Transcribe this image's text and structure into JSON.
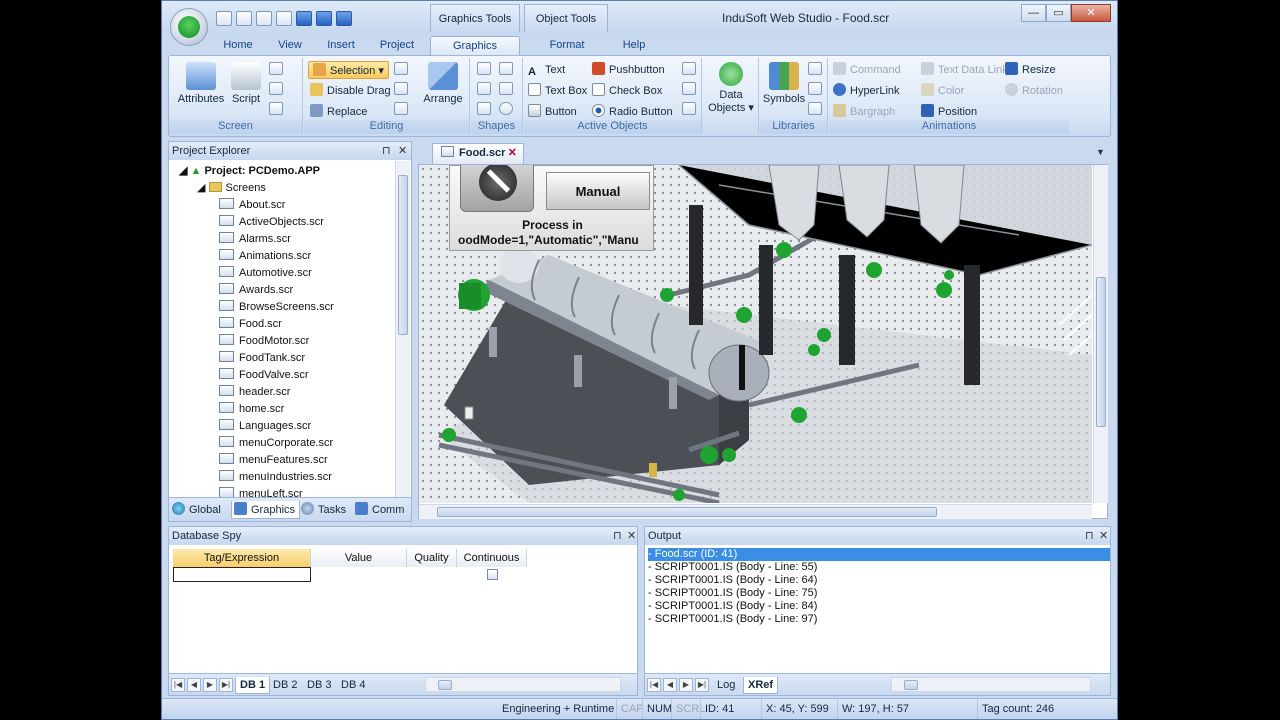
{
  "window": {
    "title": "InduSoft Web Studio - Food.scr",
    "context_tabs": [
      "Graphics Tools",
      "Object Tools"
    ],
    "controls": [
      "—",
      "▭",
      "✕"
    ]
  },
  "ribbon_tabs": [
    "Home",
    "View",
    "Insert",
    "Project",
    "Graphics",
    "Format",
    "Help"
  ],
  "ribbon": {
    "screen": {
      "label": "Screen",
      "attributes": "Attributes",
      "script": "Script"
    },
    "editing": {
      "label": "Editing",
      "selection": "Selection",
      "disable_drag": "Disable Drag",
      "replace": "Replace",
      "arrange": "Arrange"
    },
    "shapes": {
      "label": "Shapes"
    },
    "active_objects": {
      "label": "Active Objects",
      "text": "Text",
      "text_box": "Text Box",
      "button": "Button",
      "pushbutton": "Pushbutton",
      "check_box": "Check Box",
      "radio_button": "Radio Button"
    },
    "data_objects": {
      "line1": "Data",
      "line2": "Objects"
    },
    "libraries": {
      "label": "Libraries",
      "symbols": "Symbols"
    },
    "animations": {
      "label": "Animations",
      "command": "Command",
      "hyperlink": "HyperLink",
      "bargraph": "Bargraph",
      "text_data_link": "Text Data Link",
      "color": "Color",
      "position": "Position",
      "resize": "Resize",
      "rotation": "Rotation"
    }
  },
  "project_explorer": {
    "title": "Project Explorer",
    "project": "Project: PCDemo.APP",
    "screens_folder": "Screens",
    "screens": [
      "About.scr",
      "ActiveObjects.scr",
      "Alarms.scr",
      "Animations.scr",
      "Automotive.scr",
      "Awards.scr",
      "BrowseScreens.scr",
      "Food.scr",
      "FoodMotor.scr",
      "FoodTank.scr",
      "FoodValve.scr",
      "header.scr",
      "home.scr",
      "Languages.scr",
      "menuCorporate.scr",
      "menuFeatures.scr",
      "menuIndustries.scr",
      "menuLeft.scr"
    ],
    "tabs": [
      "Global",
      "Graphics",
      "Tasks",
      "Comm"
    ]
  },
  "editor": {
    "tab": "Food.scr",
    "manual_button": "Manual",
    "process_line1": "Process in",
    "process_line2": "oodMode=1,\"Automatic\",\"Manu"
  },
  "database_spy": {
    "title": "Database Spy",
    "columns": [
      "Tag/Expression",
      "Value",
      "Quality",
      "Continuous"
    ],
    "tabs": [
      "DB 1",
      "DB 2",
      "DB 3",
      "DB 4"
    ]
  },
  "output": {
    "title": "Output",
    "lines": [
      "- Food.scr (ID: 41)",
      "- SCRIPT0001.IS (Body - Line: 55)",
      "- SCRIPT0001.IS (Body - Line: 64)",
      "- SCRIPT0001.IS (Body - Line: 75)",
      "- SCRIPT0001.IS (Body - Line: 84)",
      "- SCRIPT0001.IS (Body - Line: 97)"
    ],
    "tabs": [
      "Log",
      "XRef"
    ]
  },
  "status_bar": {
    "mode": "Engineering + Runtime",
    "cap": "CAP",
    "num": "NUM",
    "scrl": "SCRL",
    "id": "ID: 41",
    "coords": "X: 45, Y: 599",
    "size": "W: 197, H: 57",
    "tag_count": "Tag count: 246"
  },
  "colors": {
    "accent": "#3a8ee6",
    "ribbon_bg": "#dbe7f6",
    "chrome": "#c9daf0",
    "valve_green": "#1fa331"
  }
}
